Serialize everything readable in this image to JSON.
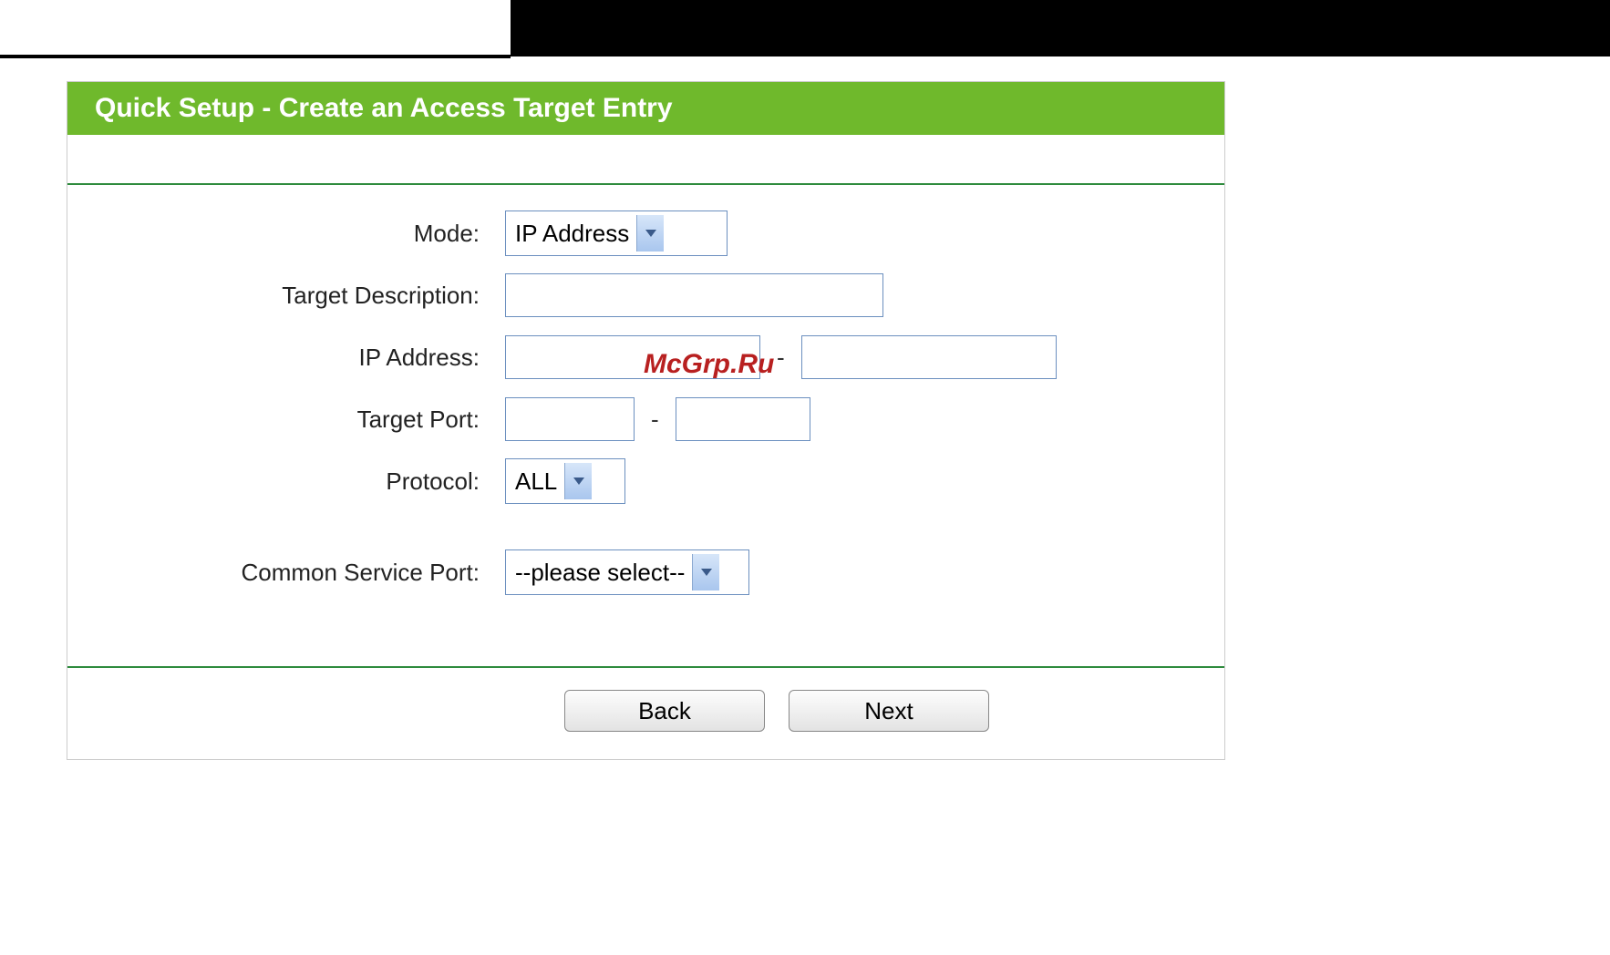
{
  "header": {
    "title": "Quick Setup - Create an Access Target Entry"
  },
  "form": {
    "mode": {
      "label": "Mode:",
      "value": "IP Address"
    },
    "targetDescription": {
      "label": "Target Description:",
      "value": ""
    },
    "ipAddress": {
      "label": "IP Address:",
      "start": "",
      "end": "",
      "separator": "-"
    },
    "targetPort": {
      "label": "Target Port:",
      "start": "",
      "end": "",
      "separator": "-"
    },
    "protocol": {
      "label": "Protocol:",
      "value": "ALL"
    },
    "commonServicePort": {
      "label": "Common Service Port:",
      "value": "--please select--"
    }
  },
  "buttons": {
    "back": "Back",
    "next": "Next"
  },
  "watermark": "McGrp.Ru"
}
